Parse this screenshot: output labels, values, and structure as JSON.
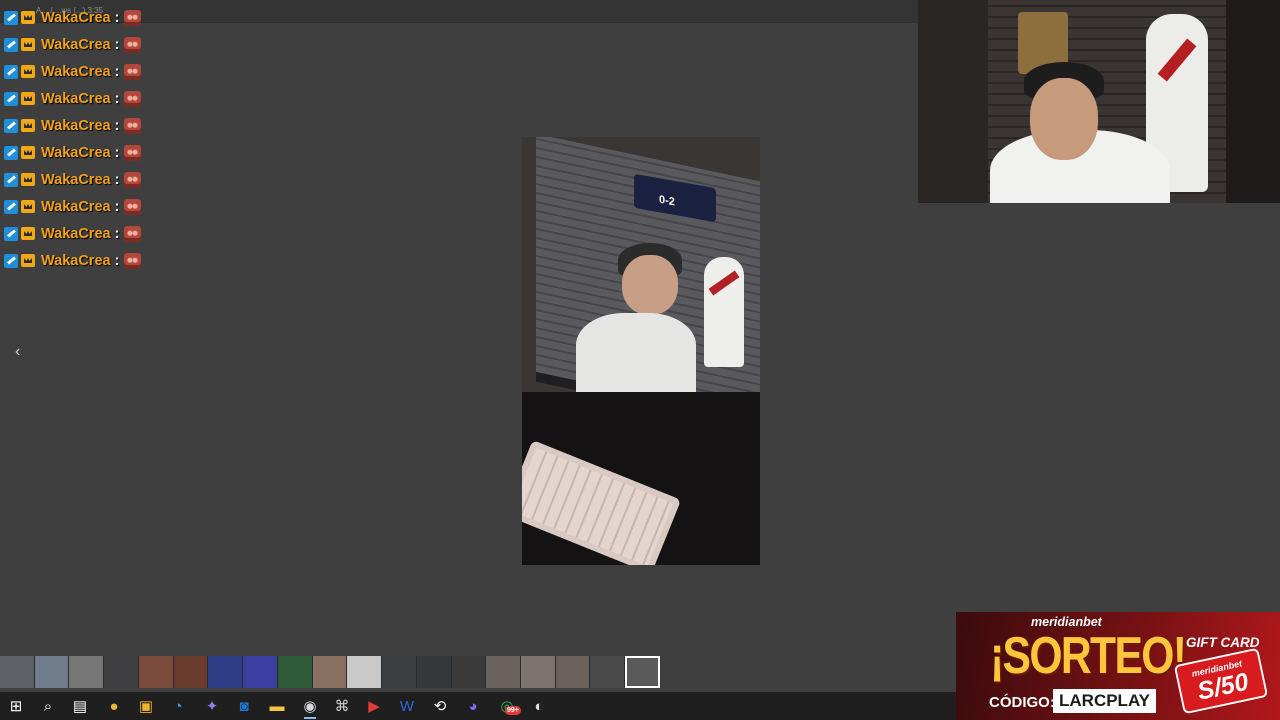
{
  "window": {
    "title": "A... / ...ws (...) 3:35"
  },
  "chat": {
    "messages": [
      {
        "user": "WakaCrea",
        "separator": ":"
      },
      {
        "user": "WakaCrea",
        "separator": ":"
      },
      {
        "user": "WakaCrea",
        "separator": ":"
      },
      {
        "user": "WakaCrea",
        "separator": ":"
      },
      {
        "user": "WakaCrea",
        "separator": ":"
      },
      {
        "user": "WakaCrea",
        "separator": ":"
      },
      {
        "user": "WakaCrea",
        "separator": ":"
      },
      {
        "user": "WakaCrea",
        "separator": ":"
      },
      {
        "user": "WakaCrea",
        "separator": ":"
      },
      {
        "user": "WakaCrea",
        "separator": ":"
      }
    ]
  },
  "viewer": {
    "back_glyph": "‹",
    "score": "0-2"
  },
  "thumbnail_strip": {
    "count": 19,
    "selected_index": 18
  },
  "taskbar": {
    "items": [
      "windows-start",
      "search",
      "task-view",
      "chrome",
      "store",
      "edge",
      "copilot",
      "outlook",
      "file-explorer",
      "obs",
      "gamepad",
      "video-editor",
      "word",
      "capcut",
      "discord",
      "whatsapp",
      "browser"
    ],
    "whatsapp_badge": "99+"
  },
  "promo": {
    "brand": "meridianbet",
    "title": "¡SORTEO!",
    "code_label": "CÓDIGO:",
    "code": "LARCPLAY",
    "gift_label": "GIFT CARD",
    "card_brand": "meridianbet",
    "card_amount": "S/50",
    "colors": {
      "gold": "#ffc53d",
      "red": "#d81b1f"
    }
  }
}
